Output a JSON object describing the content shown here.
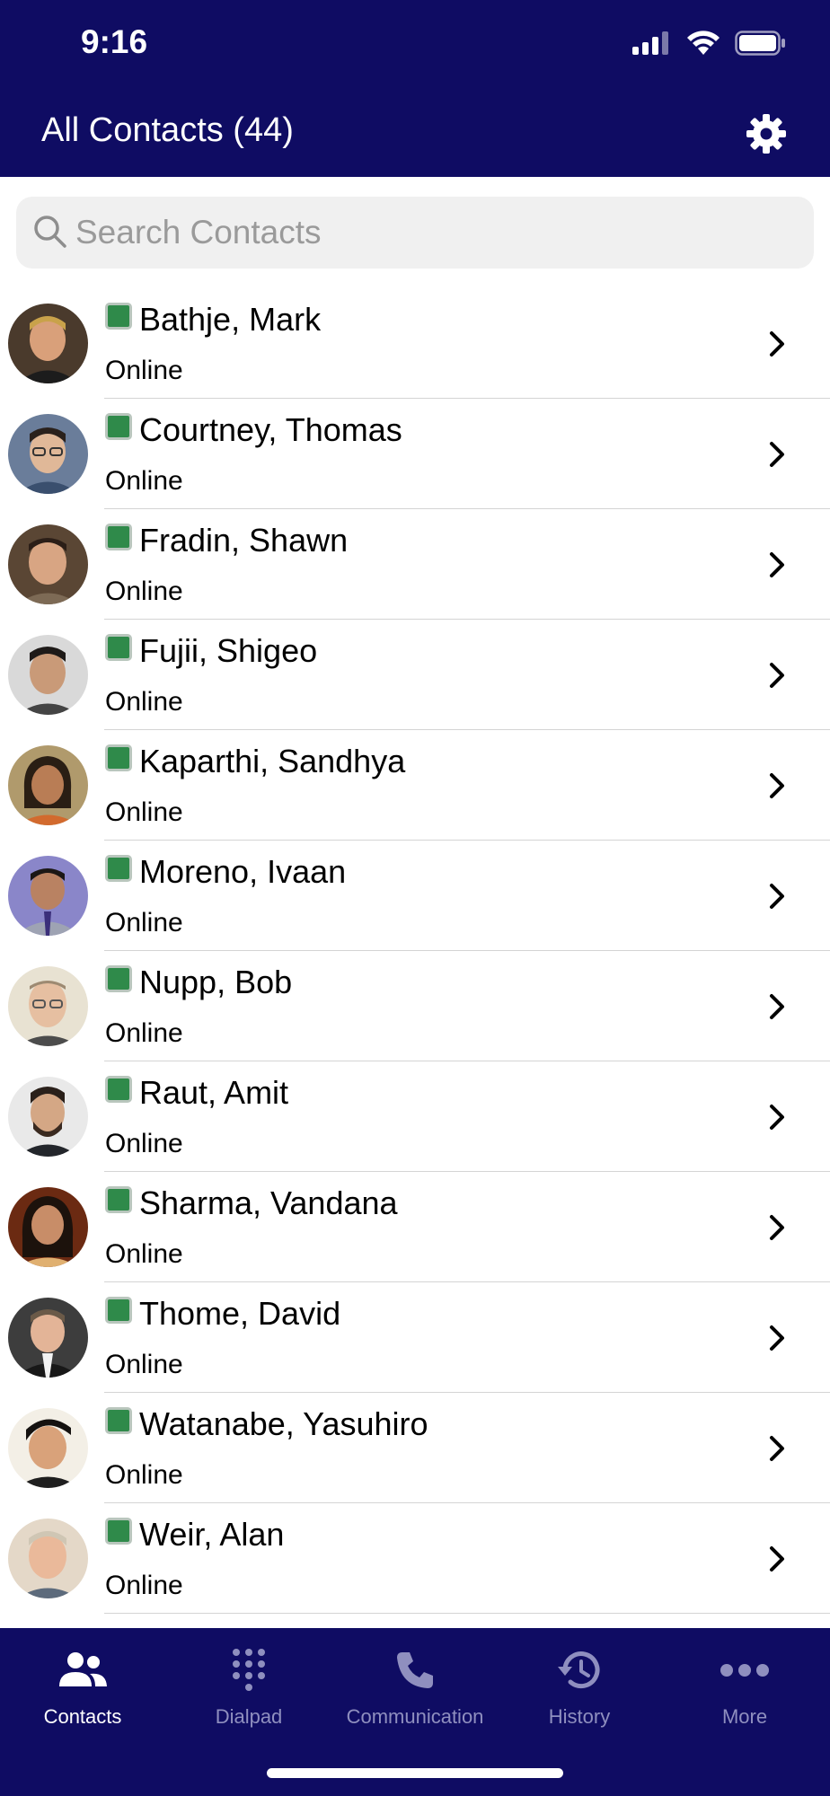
{
  "status_bar": {
    "time": "9:16"
  },
  "header": {
    "title": "All Contacts (44)"
  },
  "search": {
    "placeholder": "Search Contacts",
    "value": ""
  },
  "contacts": [
    {
      "name": "Bathje, Mark",
      "status": "Online"
    },
    {
      "name": "Courtney, Thomas",
      "status": "Online"
    },
    {
      "name": "Fradin, Shawn",
      "status": "Online"
    },
    {
      "name": "Fujii, Shigeo",
      "status": "Online"
    },
    {
      "name": "Kaparthi, Sandhya",
      "status": "Online"
    },
    {
      "name": "Moreno, Ivaan",
      "status": "Online"
    },
    {
      "name": "Nupp, Bob",
      "status": "Online"
    },
    {
      "name": "Raut, Amit",
      "status": "Online"
    },
    {
      "name": "Sharma, Vandana",
      "status": "Online"
    },
    {
      "name": "Thome, David",
      "status": "Online"
    },
    {
      "name": "Watanabe, Yasuhiro",
      "status": "Online"
    },
    {
      "name": "Weir, Alan",
      "status": "Online"
    }
  ],
  "tabs": [
    {
      "label": "Contacts",
      "icon": "people-icon",
      "active": true
    },
    {
      "label": "Dialpad",
      "icon": "dialpad-icon",
      "active": false
    },
    {
      "label": "Communication",
      "icon": "phone-icon",
      "active": false
    },
    {
      "label": "History",
      "icon": "history-icon",
      "active": false
    },
    {
      "label": "More",
      "icon": "more-icon",
      "active": false
    }
  ],
  "colors": {
    "nav_background": "#0f0c63",
    "presence_online": "#2f8a4a",
    "tab_inactive": "#8f8fbf",
    "tab_active": "#ffffff"
  }
}
